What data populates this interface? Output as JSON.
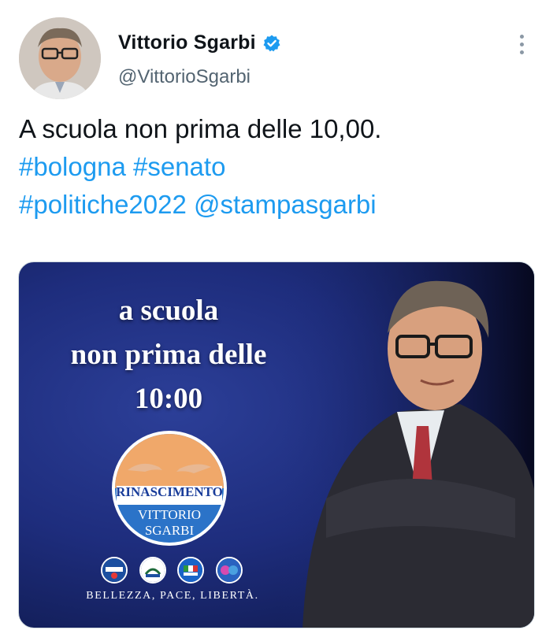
{
  "author": {
    "display_name": "Vittorio Sgarbi",
    "handle": "@VittorioSgarbi",
    "verified": true,
    "verified_color": "#1d9bf0",
    "avatar_icon": "avatar-photo"
  },
  "more_menu": {
    "icon": "more-vertical-icon"
  },
  "tweet": {
    "text_plain": "A scuola non prima delle 10,00.",
    "hashtags": [
      "#bologna",
      "#senato",
      "#politiche2022"
    ],
    "mention": "@stampasgarbi",
    "link_color": "#1d9bf0"
  },
  "media": {
    "poster_lines": [
      "a scuola",
      "non prima delle",
      "10:00"
    ],
    "logo_title": "RINASCIMENTO",
    "logo_name_lines": [
      "VITTORIO",
      "SGARBI"
    ],
    "party_logos": [
      "party-logo-meloni",
      "party-logo-lega-salvini",
      "party-logo-forza-italia",
      "party-logo-noi-moderati"
    ],
    "slogan": "BELLEZZA, PACE, LIBERTÀ.",
    "background_color": "#1e2d7d"
  }
}
